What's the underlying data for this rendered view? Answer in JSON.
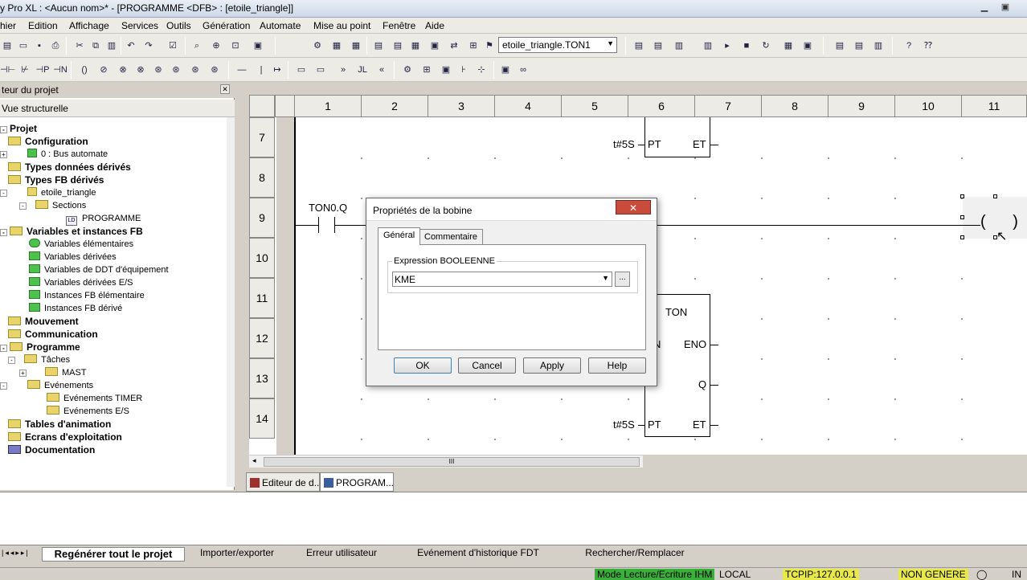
{
  "window": {
    "title": "y Pro XL : <Aucun nom>* - [PROGRAMME <DFB> : [etoile_triangle]]",
    "min": "▁",
    "max": "▣"
  },
  "menu": [
    "hier",
    "Edition",
    "Affichage",
    "Services",
    "Outils",
    "Génération",
    "Automate",
    "Mise au point",
    "Fenêtre",
    "Aide"
  ],
  "toolbar": {
    "combo_value": "etoile_triangle.TON1"
  },
  "browser": {
    "header": "teur du projet",
    "view": "Vue structurelle",
    "items": [
      {
        "label": "Projet",
        "bold": true
      },
      {
        "label": "Configuration",
        "bold": true
      },
      {
        "label": "0 : Bus automate",
        "bold": false
      },
      {
        "label": "Types données dérivés",
        "bold": true
      },
      {
        "label": "Types FB dérivés",
        "bold": true
      },
      {
        "label": "etoile_triangle",
        "bold": false
      },
      {
        "label": "Sections",
        "bold": false
      },
      {
        "label": "PROGRAMME",
        "bold": false
      },
      {
        "label": "Variables et instances FB",
        "bold": true
      },
      {
        "label": "Variables élémentaires",
        "bold": false
      },
      {
        "label": "Variables dérivées",
        "bold": false
      },
      {
        "label": "Variables de DDT d'équipement",
        "bold": false
      },
      {
        "label": "Variables dérivées E/S",
        "bold": false
      },
      {
        "label": "Instances FB élémentaire",
        "bold": false
      },
      {
        "label": "Instances FB dérivé",
        "bold": false
      },
      {
        "label": "Mouvement",
        "bold": true
      },
      {
        "label": "Communication",
        "bold": true
      },
      {
        "label": "Programme",
        "bold": true
      },
      {
        "label": "Tâches",
        "bold": false
      },
      {
        "label": "MAST",
        "bold": false
      },
      {
        "label": "Evénements",
        "bold": false
      },
      {
        "label": "Evénements TIMER",
        "bold": false
      },
      {
        "label": "Evénements E/S",
        "bold": false
      },
      {
        "label": "Tables d'animation",
        "bold": true
      },
      {
        "label": "Ecrans d'exploitation",
        "bold": true
      },
      {
        "label": "Documentation",
        "bold": true
      }
    ]
  },
  "ladder": {
    "columns": [
      "1",
      "2",
      "3",
      "4",
      "5",
      "6",
      "7",
      "8",
      "9",
      "10",
      "11"
    ],
    "rows": [
      "7",
      "8",
      "9",
      "10",
      "11",
      "12",
      "13",
      "14"
    ],
    "contact_label": "TON0.Q",
    "top_block": {
      "pt_input": "t#5S",
      "pt": "PT",
      "et": "ET"
    },
    "ton_block": {
      "type": "TON",
      "en": "N",
      "eno": "ENO",
      "in": "IN",
      "q": "Q",
      "pt_input": "t#5S",
      "pt": "PT",
      "et": "ET"
    },
    "coil": "( )"
  },
  "scroll": {
    "thumb": "III"
  },
  "doc_tabs": [
    "Editeur de d...",
    "PROGRAM..."
  ],
  "bottom_tabs": [
    "Regénérer tout le projet",
    "Importer/exporter",
    "Erreur utilisateur",
    "Evénement d'historique FDT",
    "Rechercher/Remplacer"
  ],
  "status": [
    "Mode Lecture/Ecriture IHM",
    "LOCAL",
    "TCPIP:127.0.0.1",
    "NON GENERE",
    "IN"
  ],
  "dialog": {
    "title": "Propriétés de la bobine",
    "close": "✕",
    "tabs": [
      "Général",
      "Commentaire"
    ],
    "group_label": "Expression BOOLEENNE",
    "input_value": "KME",
    "browse": "...",
    "buttons": [
      "OK",
      "Cancel",
      "Apply",
      "Help"
    ]
  }
}
